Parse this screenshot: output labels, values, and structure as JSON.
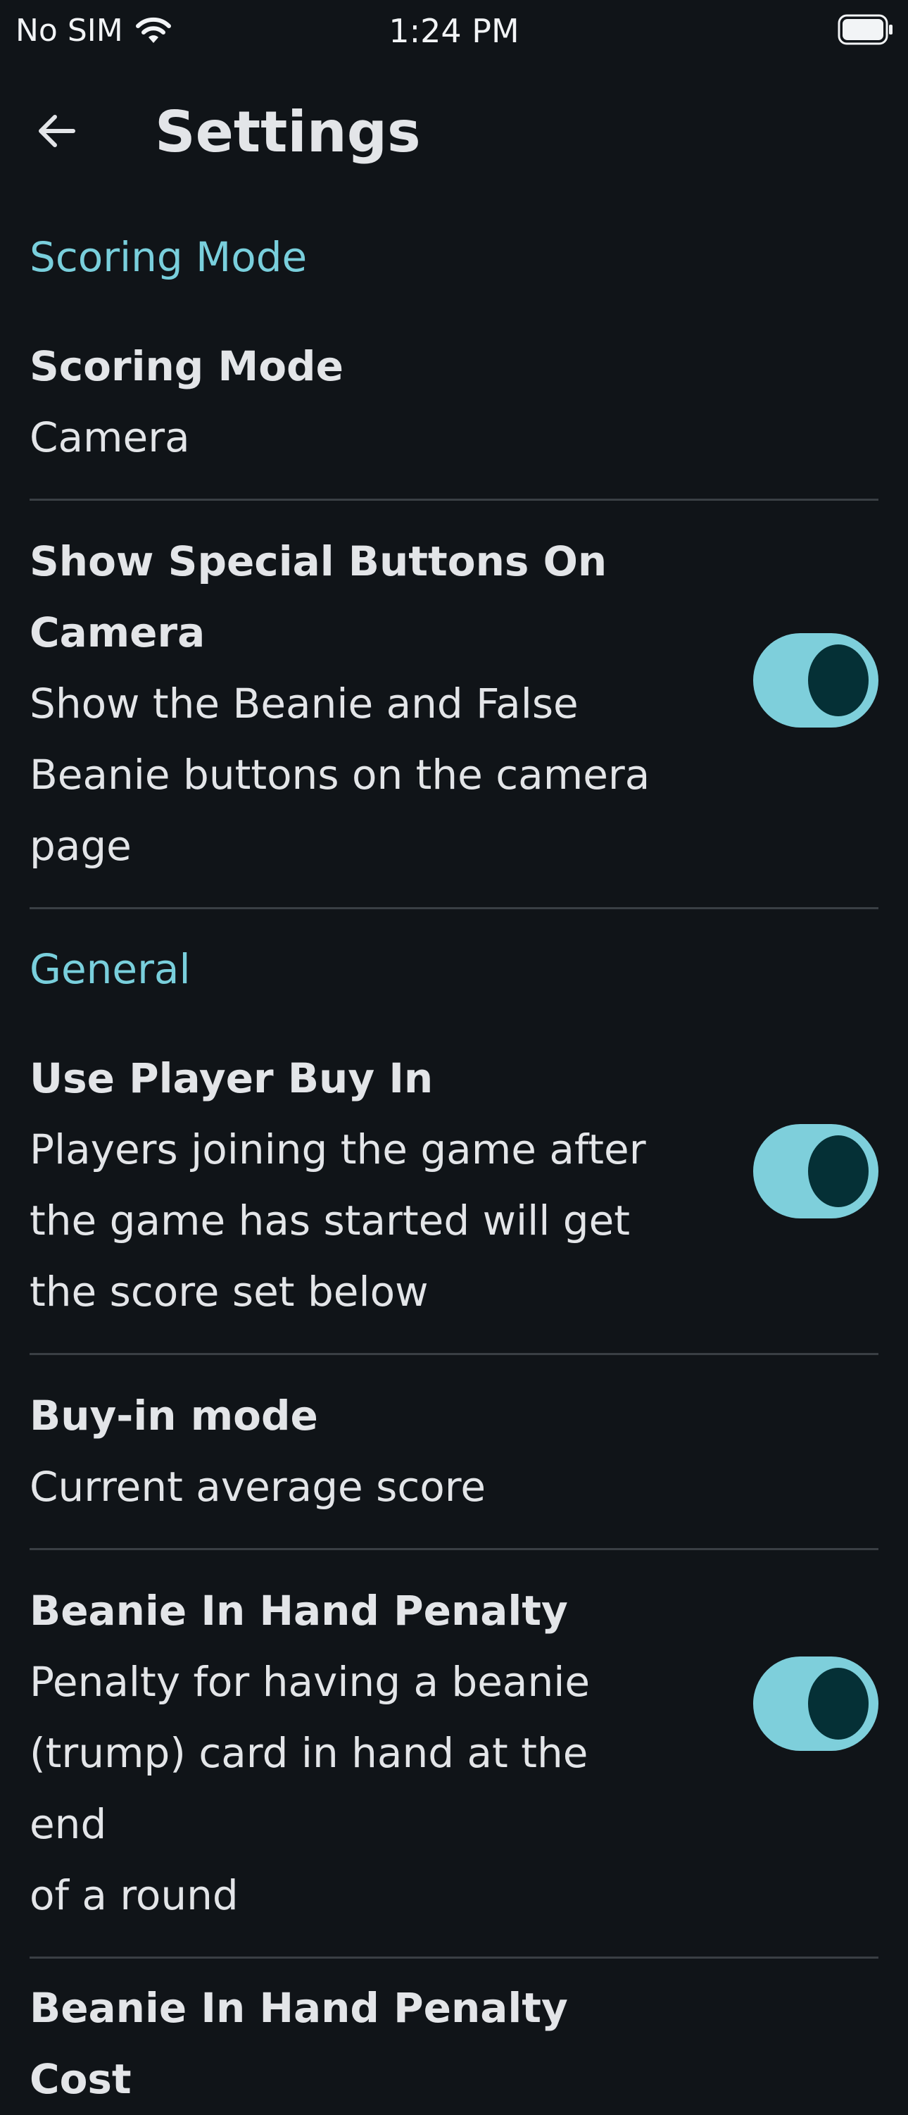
{
  "status_bar": {
    "carrier": "No SIM",
    "time": "1:24 PM"
  },
  "app_bar": {
    "title": "Settings"
  },
  "sections": {
    "scoring": {
      "header": "Scoring Mode",
      "scoring_mode": {
        "title": "Scoring Mode",
        "value": "Camera"
      },
      "special_buttons": {
        "title_line1": "Show Special Buttons On",
        "title_line2": "Camera",
        "desc_line1": "Show the Beanie and False",
        "desc_line2": "Beanie buttons on the camera",
        "desc_line3": "page",
        "enabled": true
      }
    },
    "general": {
      "header": "General",
      "player_buy_in": {
        "title": "Use Player Buy In",
        "desc_line1": "Players joining the game after",
        "desc_line2": "the game has started will get",
        "desc_line3": "the score set below",
        "enabled": true
      },
      "buy_in_mode": {
        "title": "Buy-in mode",
        "value": "Current average score"
      },
      "beanie_penalty": {
        "title": "Beanie In Hand Penalty",
        "desc_line1": "Penalty for having a beanie",
        "desc_line2": "(trump) card in hand at the end",
        "desc_line3": "of a round",
        "enabled": true
      },
      "beanie_penalty_cost": {
        "title": "Beanie In Hand Penalty Cost"
      }
    }
  },
  "colors": {
    "background": "#101418",
    "accent": "#79cfdc",
    "toggle_track": "#7ecfdb",
    "toggle_thumb": "#053036",
    "divider": "#3a3f44"
  },
  "icons": {
    "back": "arrow-left-icon",
    "wifi": "wifi-icon",
    "battery": "battery-icon"
  }
}
